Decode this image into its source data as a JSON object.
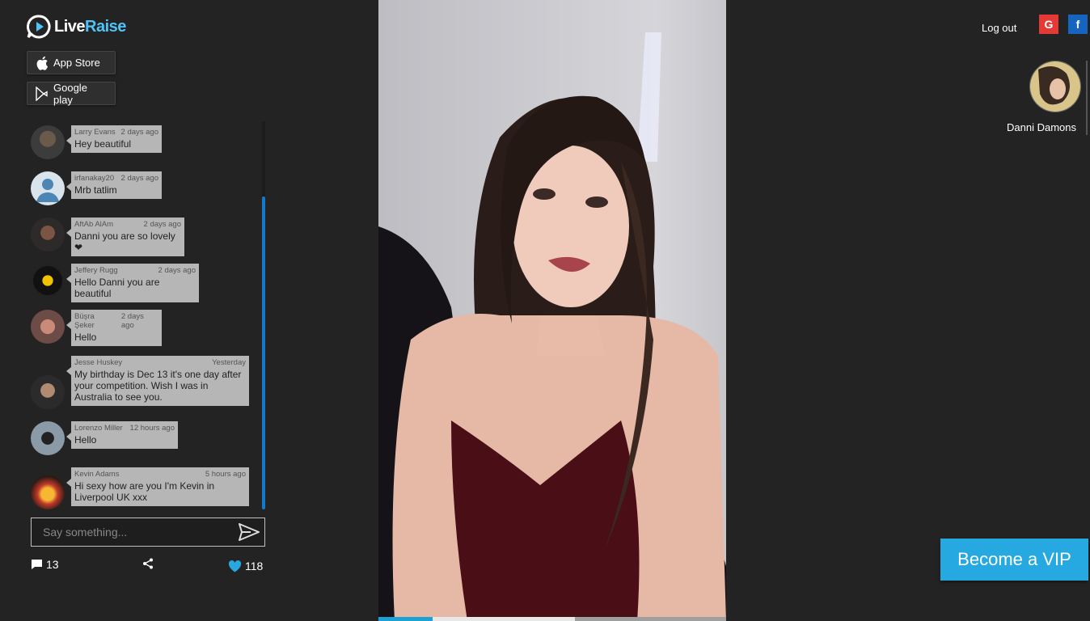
{
  "brand": {
    "part1": "Live",
    "part2": "Raise"
  },
  "stores": {
    "app_store": "App Store",
    "google_play": "Google play"
  },
  "chat": {
    "messages": [
      {
        "user": "Larry Evans",
        "time": "2 days ago",
        "text": "Hey beautiful"
      },
      {
        "user": "irfanakay20",
        "time": "2 days ago",
        "text": "Mrb tatlim"
      },
      {
        "user": "AftAb AlAm",
        "time": "2 days ago",
        "text": "Danni you are so lovely❤"
      },
      {
        "user": "Jeffery Rugg",
        "time": "2 days ago",
        "text": "Hello Danni you are beautiful"
      },
      {
        "user": "Büşra Şeker",
        "time": "2 days ago",
        "text": "Hello"
      },
      {
        "user": "Jesse Huskey",
        "time": "Yesterday",
        "text": "My birthday is Dec 13 it's one day after your competition. Wish I was in Australia to see you."
      },
      {
        "user": "Lorenzo Miller",
        "time": "12 hours ago",
        "text": "Hello"
      },
      {
        "user": "Kevin Adams",
        "time": "5 hours ago",
        "text": "Hi sexy how are you I'm Kevin in Liverpool UK xxx"
      }
    ],
    "input_placeholder": "Say something..."
  },
  "stats": {
    "comments": "13",
    "likes": "118"
  },
  "video": {
    "progress": 0.155,
    "buffered": 0.565
  },
  "header": {
    "logout": "Log out",
    "google": "G",
    "facebook": "f"
  },
  "host": {
    "name": "Danni Damons"
  },
  "vip": {
    "label": "Become a VIP"
  },
  "colors": {
    "accent": "#25a9e0",
    "bubble": "#b6b6b6",
    "google": "#e53935",
    "facebook": "#1565c0"
  }
}
